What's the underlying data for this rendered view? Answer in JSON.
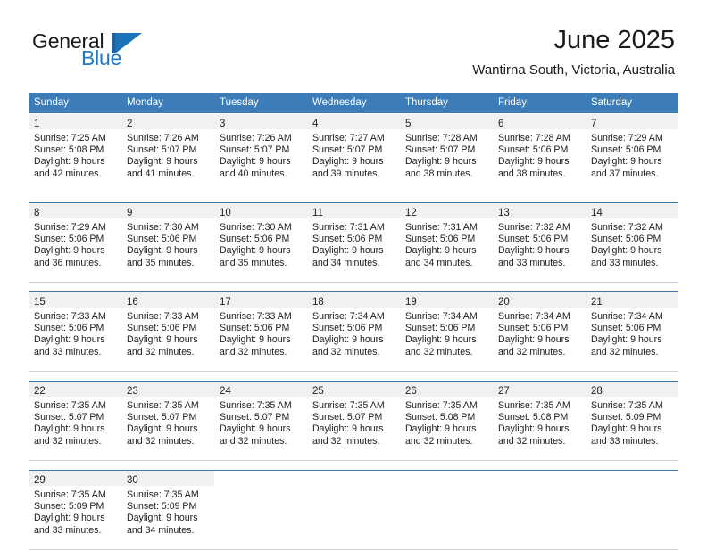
{
  "brand": {
    "name_primary": "General",
    "name_secondary": "Blue",
    "logo_icon": "triangle-flag-icon",
    "primary_color": "#2079c4",
    "header_color": "#3b7cb9"
  },
  "header": {
    "title": "June 2025",
    "subtitle": "Wantirna South, Victoria, Australia"
  },
  "calendar": {
    "weekdays": [
      "Sunday",
      "Monday",
      "Tuesday",
      "Wednesday",
      "Thursday",
      "Friday",
      "Saturday"
    ],
    "weeks": [
      [
        {
          "day": "1",
          "sunrise": "Sunrise: 7:25 AM",
          "sunset": "Sunset: 5:08 PM",
          "daylight_1": "Daylight: 9 hours",
          "daylight_2": "and 42 minutes."
        },
        {
          "day": "2",
          "sunrise": "Sunrise: 7:26 AM",
          "sunset": "Sunset: 5:07 PM",
          "daylight_1": "Daylight: 9 hours",
          "daylight_2": "and 41 minutes."
        },
        {
          "day": "3",
          "sunrise": "Sunrise: 7:26 AM",
          "sunset": "Sunset: 5:07 PM",
          "daylight_1": "Daylight: 9 hours",
          "daylight_2": "and 40 minutes."
        },
        {
          "day": "4",
          "sunrise": "Sunrise: 7:27 AM",
          "sunset": "Sunset: 5:07 PM",
          "daylight_1": "Daylight: 9 hours",
          "daylight_2": "and 39 minutes."
        },
        {
          "day": "5",
          "sunrise": "Sunrise: 7:28 AM",
          "sunset": "Sunset: 5:07 PM",
          "daylight_1": "Daylight: 9 hours",
          "daylight_2": "and 38 minutes."
        },
        {
          "day": "6",
          "sunrise": "Sunrise: 7:28 AM",
          "sunset": "Sunset: 5:06 PM",
          "daylight_1": "Daylight: 9 hours",
          "daylight_2": "and 38 minutes."
        },
        {
          "day": "7",
          "sunrise": "Sunrise: 7:29 AM",
          "sunset": "Sunset: 5:06 PM",
          "daylight_1": "Daylight: 9 hours",
          "daylight_2": "and 37 minutes."
        }
      ],
      [
        {
          "day": "8",
          "sunrise": "Sunrise: 7:29 AM",
          "sunset": "Sunset: 5:06 PM",
          "daylight_1": "Daylight: 9 hours",
          "daylight_2": "and 36 minutes."
        },
        {
          "day": "9",
          "sunrise": "Sunrise: 7:30 AM",
          "sunset": "Sunset: 5:06 PM",
          "daylight_1": "Daylight: 9 hours",
          "daylight_2": "and 35 minutes."
        },
        {
          "day": "10",
          "sunrise": "Sunrise: 7:30 AM",
          "sunset": "Sunset: 5:06 PM",
          "daylight_1": "Daylight: 9 hours",
          "daylight_2": "and 35 minutes."
        },
        {
          "day": "11",
          "sunrise": "Sunrise: 7:31 AM",
          "sunset": "Sunset: 5:06 PM",
          "daylight_1": "Daylight: 9 hours",
          "daylight_2": "and 34 minutes."
        },
        {
          "day": "12",
          "sunrise": "Sunrise: 7:31 AM",
          "sunset": "Sunset: 5:06 PM",
          "daylight_1": "Daylight: 9 hours",
          "daylight_2": "and 34 minutes."
        },
        {
          "day": "13",
          "sunrise": "Sunrise: 7:32 AM",
          "sunset": "Sunset: 5:06 PM",
          "daylight_1": "Daylight: 9 hours",
          "daylight_2": "and 33 minutes."
        },
        {
          "day": "14",
          "sunrise": "Sunrise: 7:32 AM",
          "sunset": "Sunset: 5:06 PM",
          "daylight_1": "Daylight: 9 hours",
          "daylight_2": "and 33 minutes."
        }
      ],
      [
        {
          "day": "15",
          "sunrise": "Sunrise: 7:33 AM",
          "sunset": "Sunset: 5:06 PM",
          "daylight_1": "Daylight: 9 hours",
          "daylight_2": "and 33 minutes."
        },
        {
          "day": "16",
          "sunrise": "Sunrise: 7:33 AM",
          "sunset": "Sunset: 5:06 PM",
          "daylight_1": "Daylight: 9 hours",
          "daylight_2": "and 32 minutes."
        },
        {
          "day": "17",
          "sunrise": "Sunrise: 7:33 AM",
          "sunset": "Sunset: 5:06 PM",
          "daylight_1": "Daylight: 9 hours",
          "daylight_2": "and 32 minutes."
        },
        {
          "day": "18",
          "sunrise": "Sunrise: 7:34 AM",
          "sunset": "Sunset: 5:06 PM",
          "daylight_1": "Daylight: 9 hours",
          "daylight_2": "and 32 minutes."
        },
        {
          "day": "19",
          "sunrise": "Sunrise: 7:34 AM",
          "sunset": "Sunset: 5:06 PM",
          "daylight_1": "Daylight: 9 hours",
          "daylight_2": "and 32 minutes."
        },
        {
          "day": "20",
          "sunrise": "Sunrise: 7:34 AM",
          "sunset": "Sunset: 5:06 PM",
          "daylight_1": "Daylight: 9 hours",
          "daylight_2": "and 32 minutes."
        },
        {
          "day": "21",
          "sunrise": "Sunrise: 7:34 AM",
          "sunset": "Sunset: 5:06 PM",
          "daylight_1": "Daylight: 9 hours",
          "daylight_2": "and 32 minutes."
        }
      ],
      [
        {
          "day": "22",
          "sunrise": "Sunrise: 7:35 AM",
          "sunset": "Sunset: 5:07 PM",
          "daylight_1": "Daylight: 9 hours",
          "daylight_2": "and 32 minutes."
        },
        {
          "day": "23",
          "sunrise": "Sunrise: 7:35 AM",
          "sunset": "Sunset: 5:07 PM",
          "daylight_1": "Daylight: 9 hours",
          "daylight_2": "and 32 minutes."
        },
        {
          "day": "24",
          "sunrise": "Sunrise: 7:35 AM",
          "sunset": "Sunset: 5:07 PM",
          "daylight_1": "Daylight: 9 hours",
          "daylight_2": "and 32 minutes."
        },
        {
          "day": "25",
          "sunrise": "Sunrise: 7:35 AM",
          "sunset": "Sunset: 5:07 PM",
          "daylight_1": "Daylight: 9 hours",
          "daylight_2": "and 32 minutes."
        },
        {
          "day": "26",
          "sunrise": "Sunrise: 7:35 AM",
          "sunset": "Sunset: 5:08 PM",
          "daylight_1": "Daylight: 9 hours",
          "daylight_2": "and 32 minutes."
        },
        {
          "day": "27",
          "sunrise": "Sunrise: 7:35 AM",
          "sunset": "Sunset: 5:08 PM",
          "daylight_1": "Daylight: 9 hours",
          "daylight_2": "and 32 minutes."
        },
        {
          "day": "28",
          "sunrise": "Sunrise: 7:35 AM",
          "sunset": "Sunset: 5:09 PM",
          "daylight_1": "Daylight: 9 hours",
          "daylight_2": "and 33 minutes."
        }
      ],
      [
        {
          "day": "29",
          "sunrise": "Sunrise: 7:35 AM",
          "sunset": "Sunset: 5:09 PM",
          "daylight_1": "Daylight: 9 hours",
          "daylight_2": "and 33 minutes."
        },
        {
          "day": "30",
          "sunrise": "Sunrise: 7:35 AM",
          "sunset": "Sunset: 5:09 PM",
          "daylight_1": "Daylight: 9 hours",
          "daylight_2": "and 34 minutes."
        },
        {
          "day": "",
          "sunrise": "",
          "sunset": "",
          "daylight_1": "",
          "daylight_2": ""
        },
        {
          "day": "",
          "sunrise": "",
          "sunset": "",
          "daylight_1": "",
          "daylight_2": ""
        },
        {
          "day": "",
          "sunrise": "",
          "sunset": "",
          "daylight_1": "",
          "daylight_2": ""
        },
        {
          "day": "",
          "sunrise": "",
          "sunset": "",
          "daylight_1": "",
          "daylight_2": ""
        },
        {
          "day": "",
          "sunrise": "",
          "sunset": "",
          "daylight_1": "",
          "daylight_2": ""
        }
      ]
    ]
  }
}
